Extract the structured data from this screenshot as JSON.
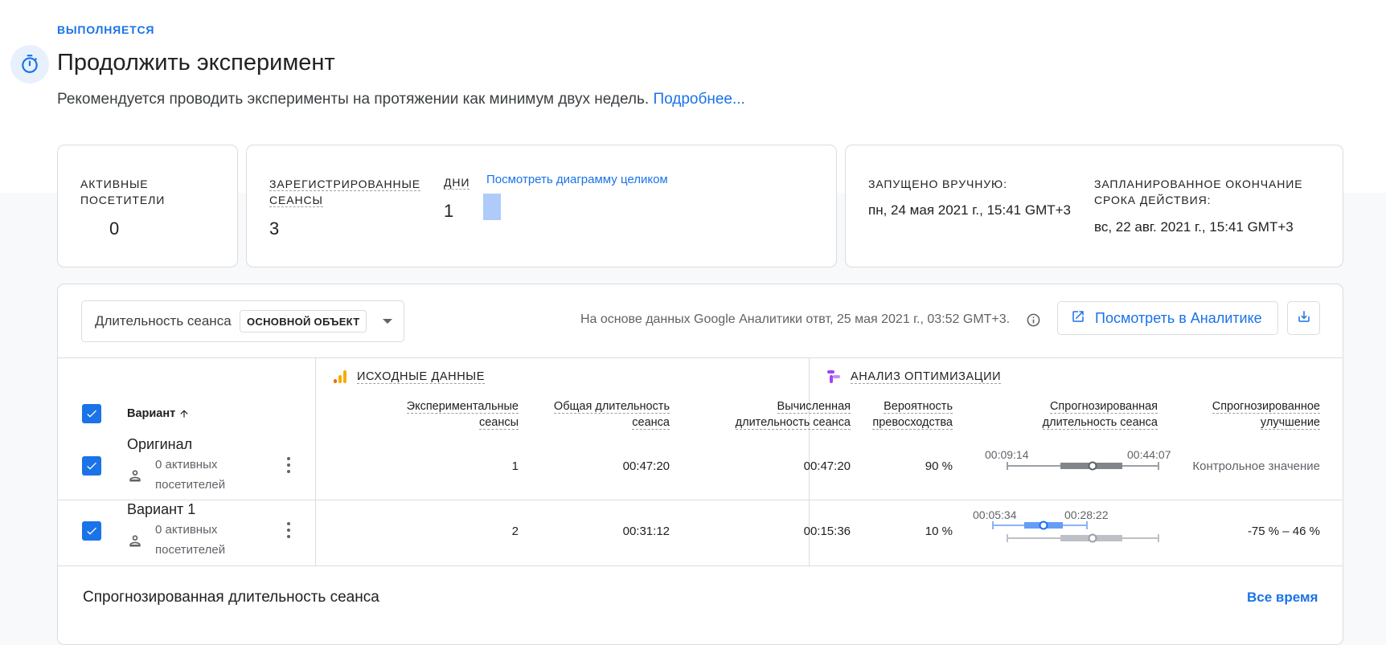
{
  "header": {
    "status": "ВЫПОЛНЯЕТСЯ",
    "title": "Продолжить эксперимент",
    "subtitle": "Рекомендуется проводить эксперименты на протяжении как минимум двух недель.",
    "learn_more": "Подробнее..."
  },
  "stats": {
    "active_label_1": "АКТИВНЫЕ",
    "active_label_2": "ПОСЕТИТЕЛИ",
    "active_value": "0",
    "sessions_label_1": "ЗАРЕГИСТРИРОВАННЫЕ",
    "sessions_label_2": "СЕАНСЫ",
    "sessions_value": "3",
    "days_label": "ДНИ",
    "days_value": "1",
    "chart_link": "Посмотреть диаграмму целиком",
    "started_label": "ЗАПУЩЕНО ВРУЧНУЮ:",
    "started_value": "пн, 24 мая 2021 г., 15:41 GMT+3",
    "end_label_1": "ЗАПЛАНИРОВАННОЕ ОКОНЧАНИЕ",
    "end_label_2": "СРОКА ДЕЙСТВИЯ:",
    "end_value": "вс, 22 авг. 2021 г., 15:41 GMT+3"
  },
  "toolbar": {
    "metric_label": "Длительность сеанса",
    "metric_chip": "ОСНОВНОЙ ОБЪЕКТ",
    "data_note": "На основе данных Google Аналитики отвт, 25 мая 2021 г., 03:52 GMT+3.",
    "view_button": "Посмотреть в Аналитике"
  },
  "table": {
    "variant_header": "Вариант",
    "source_section": "ИСХОДНЫЕ ДАННЫЕ",
    "analysis_section": "АНАЛИЗ ОПТИМИЗАЦИИ",
    "col_sessions_1": "Экспериментальные",
    "col_sessions_2": "сеансы",
    "col_total_1": "Общая длительность",
    "col_total_2": "сеанса",
    "col_calc_1": "Вычисленная",
    "col_calc_2": "длительность сеанса",
    "col_prob_1": "Вероятность",
    "col_prob_2": "превосходства",
    "col_pred_1": "Спрогнозированная",
    "col_pred_2": "длительность сеанса",
    "col_impr_1": "Спрогнозированное",
    "col_impr_2": "улучшение",
    "rows": [
      {
        "name": "Оригинал",
        "sub_1": "0 активных",
        "sub_2": "посетителей",
        "sessions": "1",
        "total": "00:47:20",
        "calc": "00:47:20",
        "prob": "90 %",
        "range_lo": "00:09:14",
        "range_hi": "00:44:07",
        "improvement": "Контрольное значение"
      },
      {
        "name": "Вариант 1",
        "sub_1": "0 активных",
        "sub_2": "посетителей",
        "sessions": "2",
        "total": "00:31:12",
        "calc": "00:15:36",
        "prob": "10 %",
        "range_lo": "00:05:34",
        "range_hi": "00:28:22",
        "improvement": "-75 % – 46 %"
      }
    ]
  },
  "footer": {
    "title": "Спрогнозированная длительность сеанса",
    "range_link": "Все время"
  },
  "colors": {
    "accent": "#1a73e8",
    "border": "#dadce0",
    "control_range": "#80868b",
    "variant_range": "#8ab4f8"
  }
}
